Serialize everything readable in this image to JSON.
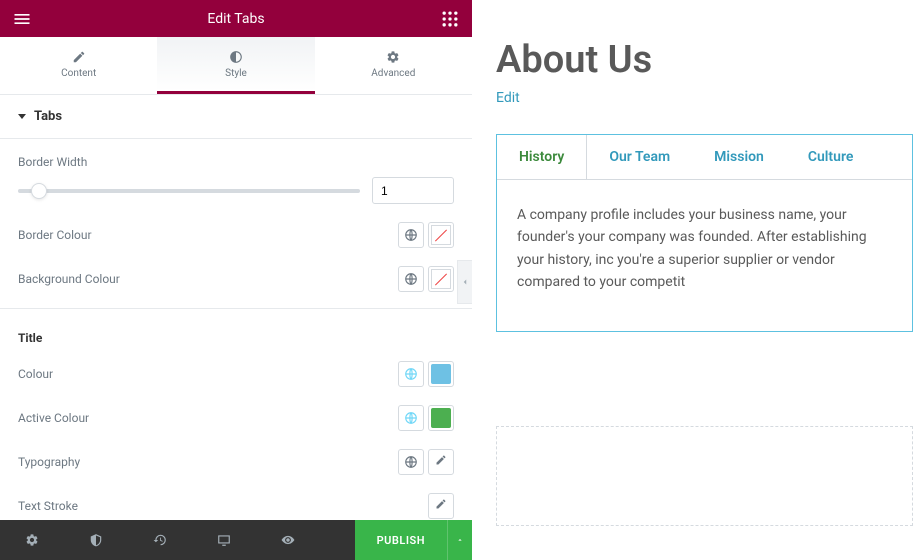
{
  "header": {
    "title": "Edit Tabs"
  },
  "editor_tabs": {
    "content": "Content",
    "style": "Style",
    "advanced": "Advanced",
    "active": "style"
  },
  "sections": {
    "tabs": {
      "title": "Tabs",
      "border_width_label": "Border Width",
      "border_width_value": "1",
      "border_colour_label": "Border Colour",
      "background_colour_label": "Background Colour"
    },
    "title": {
      "heading": "Title",
      "colour_label": "Colour",
      "colour_value": "#6ec1e4",
      "active_colour_label": "Active Colour",
      "active_colour_value": "#4caf50",
      "typography_label": "Typography",
      "text_stroke_label": "Text Stroke"
    }
  },
  "footer": {
    "publish": "PUBLISH"
  },
  "preview": {
    "page_title": "About Us",
    "edit_link": "Edit",
    "tabs": [
      {
        "label": "History",
        "active": true
      },
      {
        "label": "Our Team",
        "active": false
      },
      {
        "label": "Mission",
        "active": false
      },
      {
        "label": "Culture",
        "active": false
      }
    ],
    "content": "A company profile includes your business name, your founder's your company was founded. After establishing your history, inc you're a superior supplier or vendor compared to your competit"
  }
}
